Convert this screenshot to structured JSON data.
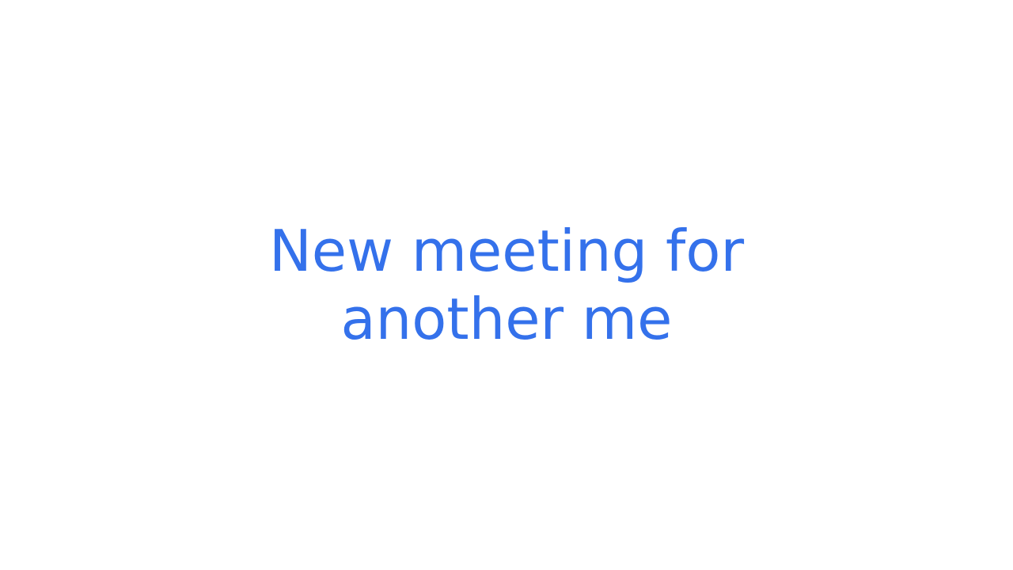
{
  "slide": {
    "title_lines": [
      "New meeting for",
      "another me"
    ]
  },
  "colors": {
    "title_text": "#3471eb",
    "background": "#ffffff"
  }
}
